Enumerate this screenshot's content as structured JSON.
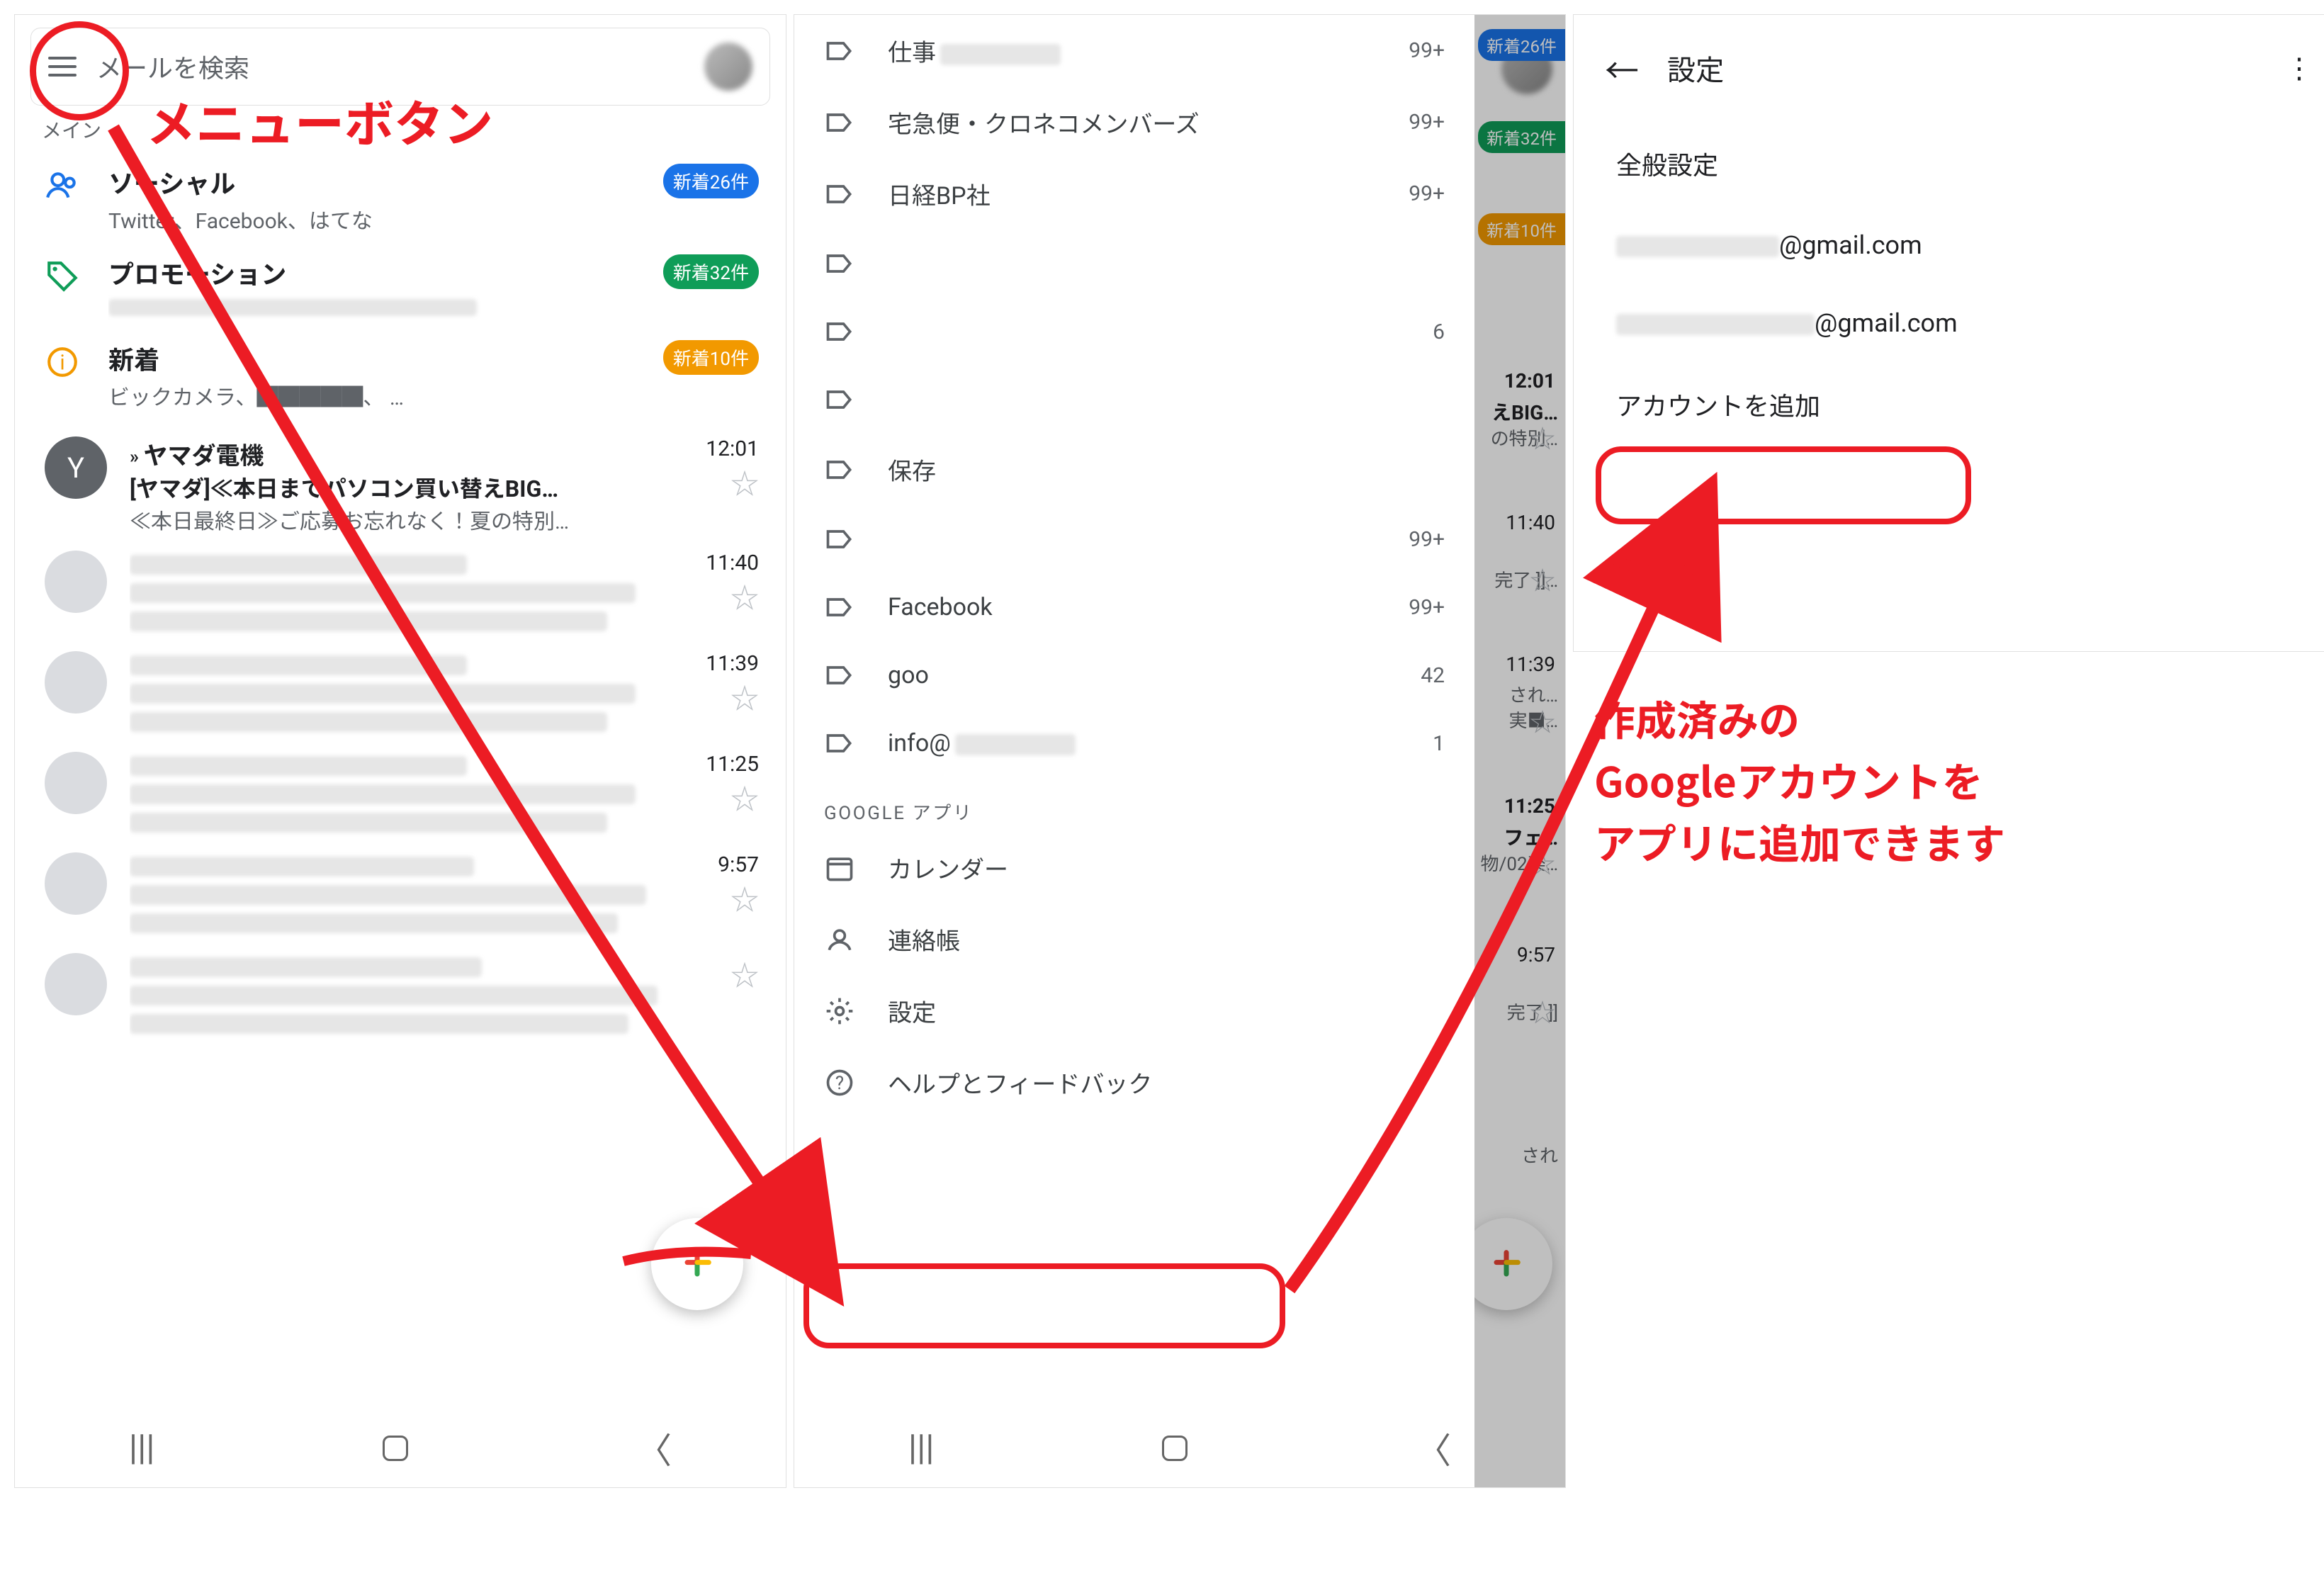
{
  "panel1": {
    "search_placeholder": "メールを検索",
    "section_label": "メイン",
    "cats": [
      {
        "title": "ソーシャル",
        "sub": "Twitter、Facebook、はてな",
        "badge": "新着26件",
        "color": "#1a73e8"
      },
      {
        "title": "プロモーション",
        "sub": "（プロモーション送信者）",
        "badge": "新着32件",
        "color": "#0f9d58"
      },
      {
        "title": "新着",
        "sub": "ビックカメラ、█████、 …",
        "badge": "新着10件",
        "color": "#f29900"
      }
    ],
    "emails": [
      {
        "sender": "ヤマダ電機",
        "subject": "[ヤマダ]≪本日までパソコン買い替えBIG…",
        "snippet": "≪本日最終日≫ご応募お忘れなく！夏の特別…",
        "time": "12:01",
        "avatar": "Y"
      },
      {
        "sender": "",
        "subject": "",
        "snippet": "",
        "time": "11:40",
        "avatar": ""
      },
      {
        "sender": "",
        "subject": "",
        "snippet": "",
        "time": "11:39",
        "avatar": ""
      },
      {
        "sender": "",
        "subject": "",
        "snippet": "",
        "time": "11:25",
        "avatar": ""
      },
      {
        "sender": "",
        "subject": "",
        "snippet": "",
        "time": "9:57",
        "avatar": ""
      },
      {
        "sender": "",
        "subject": "",
        "snippet": "",
        "time": "",
        "avatar": ""
      }
    ]
  },
  "panel2": {
    "labels": [
      {
        "name": "仕事",
        "count": "99+",
        "blur": false,
        "suffix_blur": true
      },
      {
        "name": "宅急便・クロネコメンバーズ",
        "count": "99+",
        "blur": false
      },
      {
        "name": "日経BP社",
        "count": "99+",
        "blur": false
      },
      {
        "name": "",
        "count": "",
        "blur": true
      },
      {
        "name": "",
        "count": "6",
        "blur": true
      },
      {
        "name": "",
        "count": "",
        "blur": true
      },
      {
        "name": "保存",
        "count": "",
        "blur": false
      },
      {
        "name": "",
        "count": "99+",
        "blur": true
      },
      {
        "name": "Facebook",
        "count": "99+",
        "blur": false
      },
      {
        "name": "goo",
        "count": "42",
        "blur": false
      },
      {
        "name": "info@",
        "count": "1",
        "blur": false,
        "suffix_blur": true
      }
    ],
    "google_section": "GOOGLE アプリ",
    "apps": {
      "calendar": "カレンダー",
      "contacts": "連絡帳"
    },
    "settings": "設定",
    "help": "ヘルプとフィードバック",
    "sliver": {
      "badges": [
        "新着26件",
        "新着32件",
        "新着10件"
      ],
      "times": [
        "12:01",
        "11:40",
        "11:39",
        "11:25",
        "9:57"
      ],
      "frag1": "えBIG…",
      "frag1b": "の特別…",
      "frag2": "完了 ]]…",
      "frag3": "され…",
      "frag3b": "実■…",
      "frag4": "フェ…",
      "frag4b": "物/02楽…",
      "frag5": "完了 ]]",
      "frag6": "され"
    }
  },
  "panel3": {
    "title": "設定",
    "general": "全般設定",
    "account_suffix": "@gmail.com",
    "add_account": "アカウントを追加"
  },
  "annotations": {
    "menu": "メニューボタン",
    "add_explain_l1": "作成済みの",
    "add_explain_l2": "Googleアカウントを",
    "add_explain_l3": "アプリに追加できます"
  }
}
